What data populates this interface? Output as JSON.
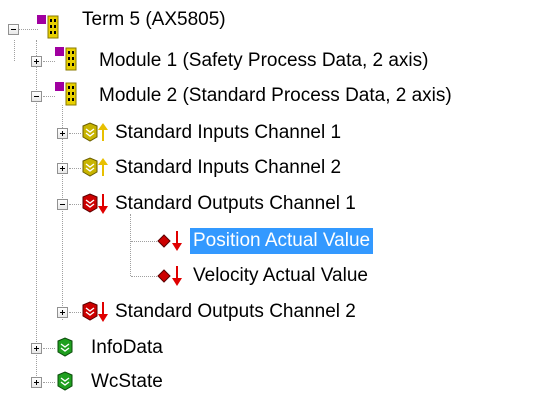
{
  "tree": {
    "term": {
      "label": "Term 5 (AX5805)",
      "icon": "terminal-module-icon"
    },
    "module1": {
      "label": "Module 1 (Safety Process Data, 2 axis)",
      "icon": "module-icon"
    },
    "module2": {
      "label": "Module 2 (Standard Process Data, 2 axis)",
      "icon": "module-icon"
    },
    "inputs1": {
      "label": "Standard Inputs Channel 1",
      "icon": "input-channel-icon"
    },
    "inputs2": {
      "label": "Standard Inputs Channel 2",
      "icon": "input-channel-icon"
    },
    "outputs1": {
      "label": "Standard Outputs Channel 1",
      "icon": "output-channel-icon"
    },
    "position": {
      "label": "Position Actual Value",
      "icon": "output-variable-icon"
    },
    "velocity": {
      "label": "Velocity Actual Value",
      "icon": "output-variable-icon"
    },
    "outputs2": {
      "label": "Standard Outputs Channel 2",
      "icon": "output-channel-icon"
    },
    "infodata": {
      "label": "InfoData",
      "icon": "info-data-icon"
    },
    "wcstate": {
      "label": "WcState",
      "icon": "wc-state-icon"
    }
  },
  "selected_item": "Position Actual Value",
  "colors": {
    "selection": "#3399ff",
    "module_magenta": "#a000a0",
    "module_yellow": "#e8d000",
    "input_yellow": "#c8b400",
    "output_red": "#cc0000",
    "green": "#1f9f1f"
  }
}
